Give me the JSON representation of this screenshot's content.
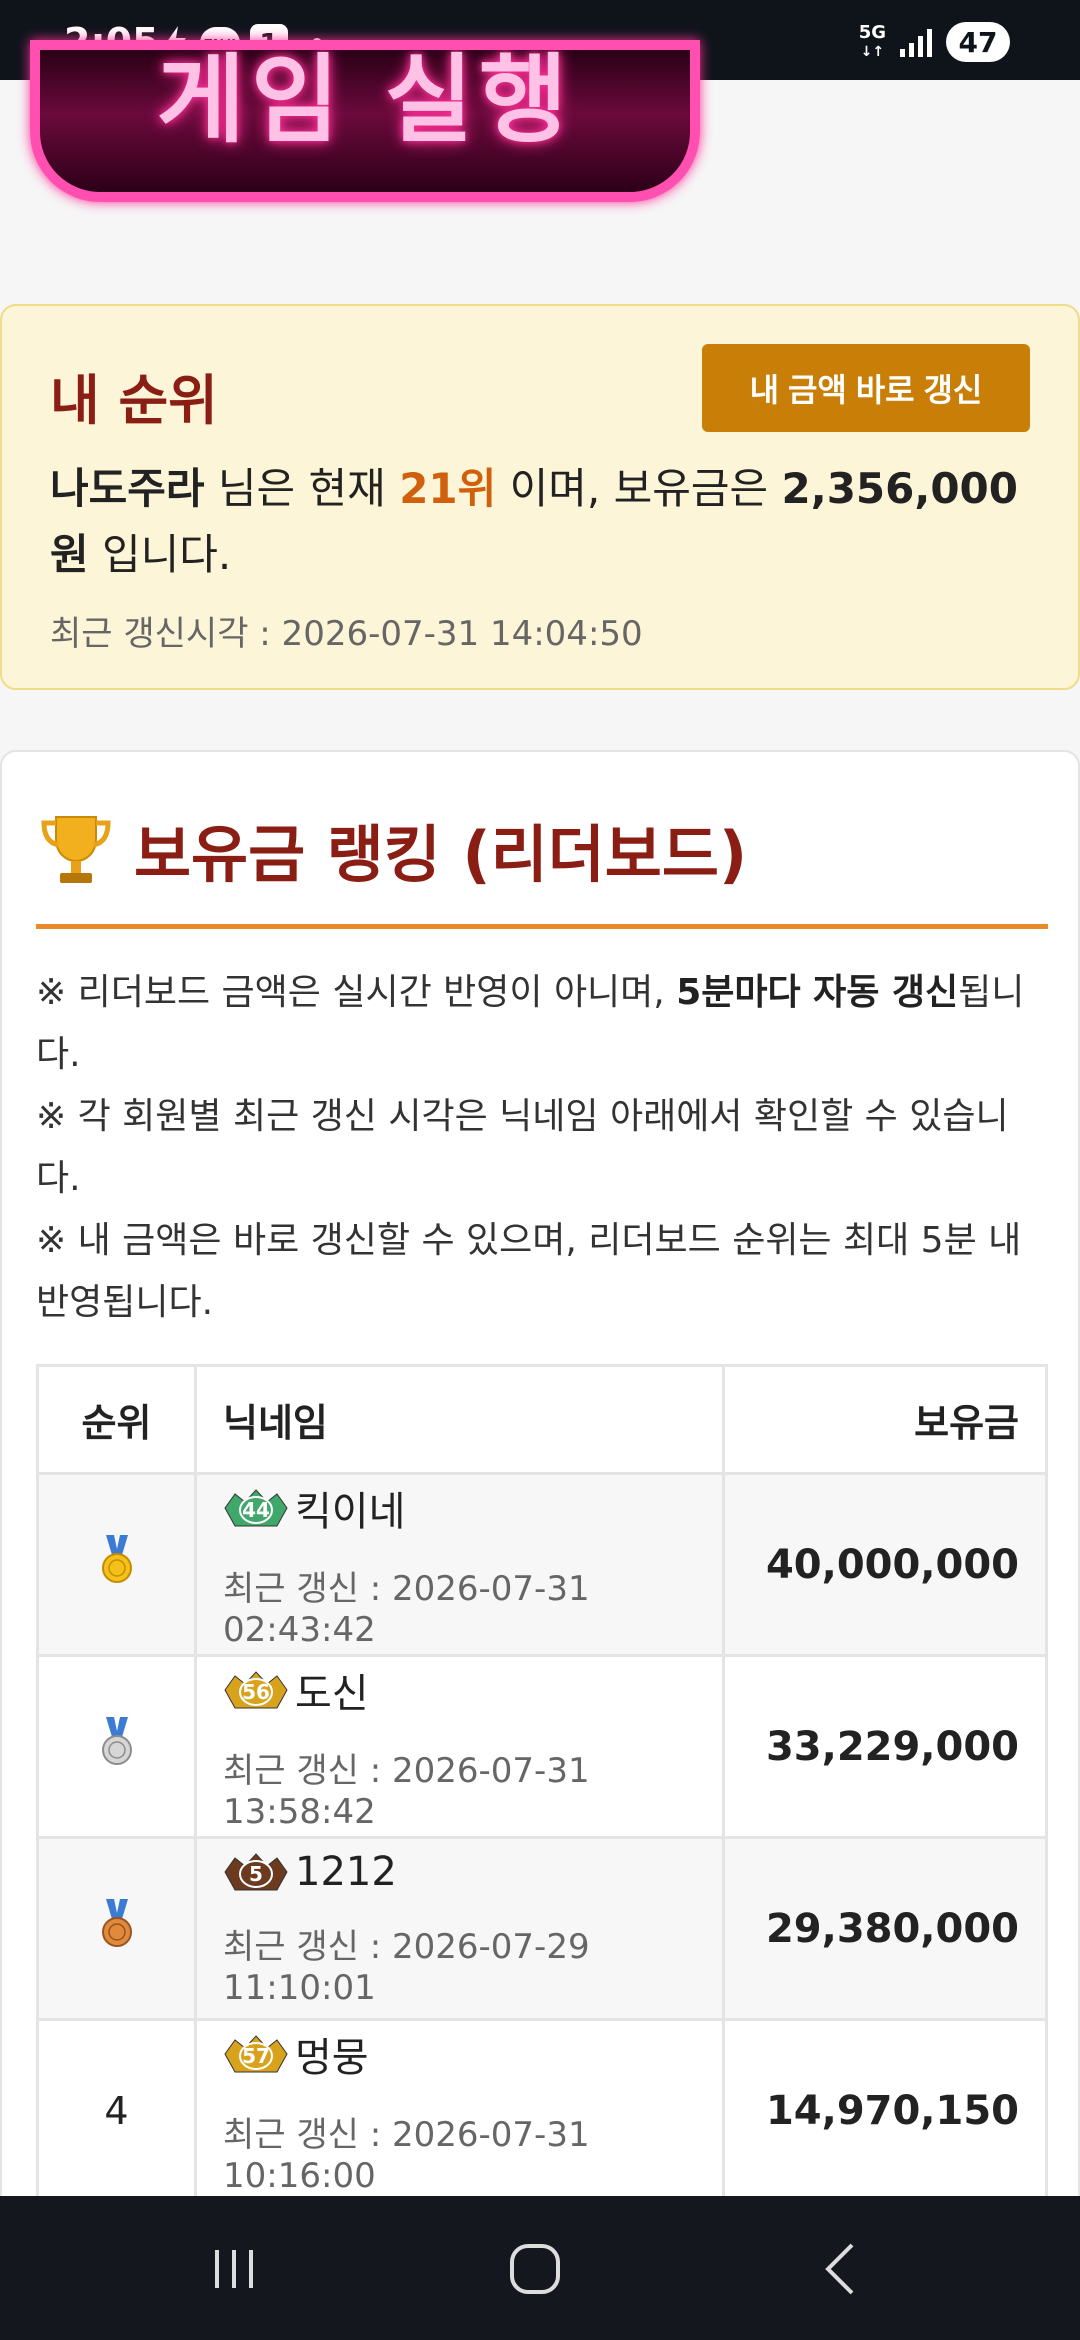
{
  "status_bar": {
    "time": "2:05",
    "talk_label": "TALK",
    "notification_count": "1",
    "network": "5G",
    "battery": "47"
  },
  "banner": {
    "text": "게임 실행"
  },
  "my_rank": {
    "title": "내 순위",
    "refresh_button": "내 금액 바로 갱신",
    "nickname": "나도주라",
    "text_1": " 님은 현재 ",
    "rank": "21위",
    "text_2": " 이며, 보유금은 ",
    "balance": "2,356,000원",
    "text_3": " 입니다.",
    "updated": "최근 갱신시각 : 2026-07-31 14:04:50"
  },
  "leaderboard": {
    "title": "보유금 랭킹 (리더보드)",
    "notes": [
      {
        "prefix": "※ 리더보드 금액은 실시간 반영이 아니며, ",
        "bold": "5분마다 자동 갱신",
        "suffix": "됩니다."
      },
      {
        "prefix": "※ 각 회원별 최근 갱신 시각은 닉네임 아래에서 확인할 수 있습니다.",
        "bold": "",
        "suffix": ""
      },
      {
        "prefix": "※ 내 금액은 바로 갱신할 수 있으며, 리더보드 순위는 최대 5분 내 반영됩니다.",
        "bold": "",
        "suffix": ""
      }
    ],
    "columns": {
      "rank": "순위",
      "nickname": "닉네임",
      "balance": "보유금"
    },
    "rows": [
      {
        "rank": "",
        "medal": "gold",
        "level": "44",
        "level_color": "#3fa86a",
        "nickname": "킥이네",
        "updated": "최근 갱신 : 2026-07-31 02:43:42",
        "balance": "40,000,000"
      },
      {
        "rank": "",
        "medal": "silver",
        "level": "56",
        "level_color": "#d9a21c",
        "nickname": "도신",
        "updated": "최근 갱신 : 2026-07-31 13:58:42",
        "balance": "33,229,000"
      },
      {
        "rank": "",
        "medal": "bronze",
        "level": "5",
        "level_color": "#6b3a1f",
        "nickname": "1212",
        "updated": "최근 갱신 : 2026-07-29 11:10:01",
        "balance": "29,380,000"
      },
      {
        "rank": "4",
        "medal": "",
        "level": "57",
        "level_color": "#d9a21c",
        "nickname": "멍뭉",
        "updated": "최근 갱신 : 2026-07-31 10:16:00",
        "balance": "14,970,150"
      }
    ]
  },
  "nav": {
    "icons": [
      "recent-apps-icon",
      "home-icon",
      "back-icon"
    ]
  }
}
